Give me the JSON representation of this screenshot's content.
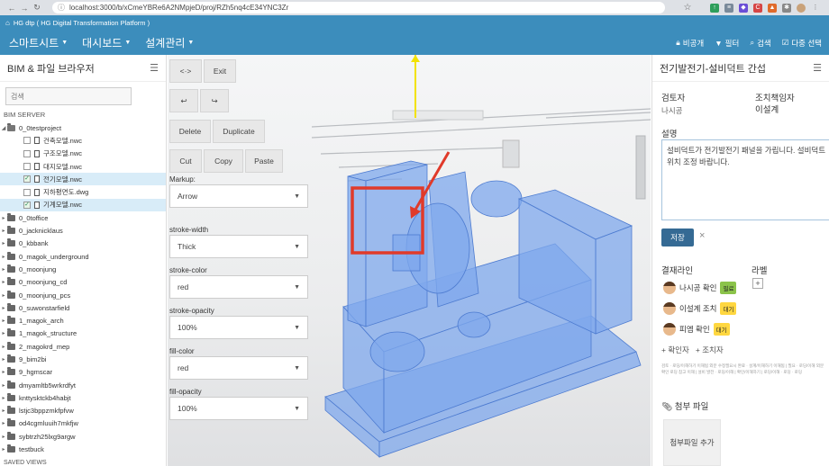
{
  "browser": {
    "url": "localhost:3000/b/xCmeYBRe6A2NMpjeD/proj/RZh5nq4cE34YNC3Zr"
  },
  "app": {
    "title": "HG dtp ( HG Digital Transformation Platform )"
  },
  "navbar": {
    "menus": [
      "스마트시트",
      "대시보드",
      "설계관리"
    ],
    "right": {
      "private": "비공개",
      "filter": "필터",
      "search": "검색",
      "multi_select": "다중 선택"
    }
  },
  "left_panel": {
    "title": "BIM & 파일 브라우저",
    "search_placeholder": "검색",
    "server_label": "BIM SERVER",
    "root": "0_0testproject",
    "files": [
      {
        "name": "건축모델.nwc",
        "checked": false,
        "selected": false
      },
      {
        "name": "구조모델.nwc",
        "checked": false,
        "selected": false
      },
      {
        "name": "대지모델.nwc",
        "checked": false,
        "selected": false
      },
      {
        "name": "전기모델.nwc",
        "checked": true,
        "selected": true
      },
      {
        "name": "지하평면도.dwg",
        "checked": false,
        "selected": false
      },
      {
        "name": "기계모델.nwc",
        "checked": true,
        "selected": true
      }
    ],
    "folders": [
      "0_0toffice",
      "0_jacknicklaus",
      "0_kbbank",
      "0_magok_underground",
      "0_moonjung",
      "0_moonjung_cd",
      "0_moonjung_pcs",
      "0_suwonstarfield",
      "1_magok_arch",
      "1_magok_structure",
      "2_magokrd_mep",
      "9_bim2bi",
      "9_hgmscar",
      "dmyamltb5wrkrdfyt",
      "knttysktckb4habjt",
      "lstjc3bppzmkfpfvw",
      "od4cgmluuih7mkfjw",
      "sybtrzh25lxg9argw",
      "testbuck"
    ],
    "saved_views": "SAVED VIEWS"
  },
  "markup_panel": {
    "buttons": {
      "code": "<·>",
      "exit": "Exit",
      "undo": "↩",
      "redo": "↪",
      "delete": "Delete",
      "duplicate": "Duplicate",
      "cut": "Cut",
      "copy": "Copy",
      "paste": "Paste"
    },
    "fields": [
      {
        "label": "Markup:",
        "value": "Arrow"
      },
      {
        "label": "stroke-width",
        "value": "Thick"
      },
      {
        "label": "stroke-color",
        "value": "red"
      },
      {
        "label": "stroke-opacity",
        "value": "100%"
      },
      {
        "label": "fill-color",
        "value": "red"
      },
      {
        "label": "fill-opacity",
        "value": "100%"
      }
    ]
  },
  "right_panel": {
    "title": "전기발전기-설비덕트 간섭",
    "reviewer_label": "검토자",
    "reviewer_value": "나시공",
    "action_owner_label": "조치책임자",
    "action_owner_value": "이설계",
    "description_label": "설명",
    "description_text": "설비덕트가 전기발전기 패널을 가립니다. 설비덕트 위치 조정 바랍니다.",
    "save_label": "저장",
    "close_label": "×",
    "approval_label": "결재라인",
    "label_label": "라벨",
    "add_label": "+",
    "approvals": [
      {
        "text": "나시공 확인",
        "status": "필료",
        "status_color": "#8bc34a"
      },
      {
        "text": "이설계 조치",
        "status": "대기",
        "status_color": "#ffd740"
      },
      {
        "text": "피엠 확인",
        "status": "대기",
        "status_color": "#ffd740"
      }
    ],
    "add_reviewer": "+ 확인자",
    "add_actor": "+ 조치자",
    "log_text": "검토 · 로딩/이해하기 이해됨 외분 수정필요시 완료 · 설계/이해하기 이해됨 | 필요 · 로딩/이해 외분 확인 로딩 참고 이해 | 설비 발전 · 로딩/이해 | 확인/이해하기 | 로딩/이해 · 로딩 · 로딩",
    "attachments_label": "첨부 파일",
    "add_attachment": "첨부파일 추가"
  },
  "colors": {
    "navbar": "#3c8dbc",
    "save_button": "#356a94",
    "markup_red": "#e03a2a"
  }
}
